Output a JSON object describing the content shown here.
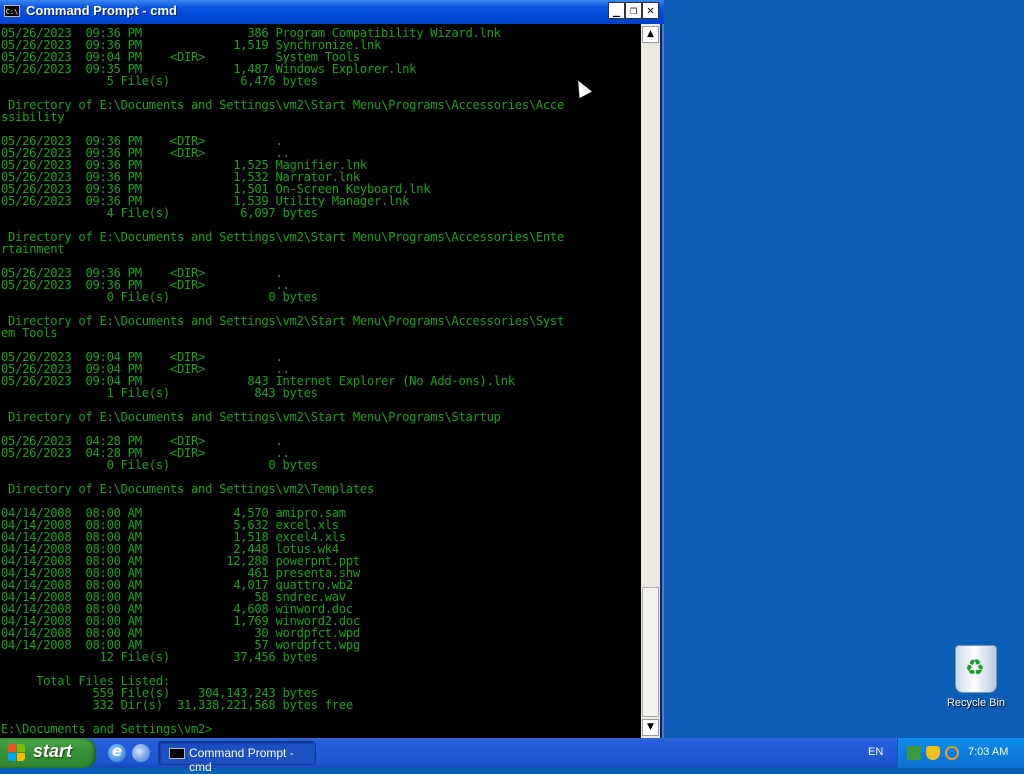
{
  "window": {
    "title": "Command Prompt - cmd",
    "titlebar_icon": "C:\\",
    "minimize_label": "_",
    "maximize_label": "❐",
    "close_label": "✕",
    "console_lines": [
      "05/26/2023  09:36 PM               386 Program Compatibility Wizard.lnk",
      "05/26/2023  09:36 PM             1,519 Synchronize.lnk",
      "05/26/2023  09:04 PM    <DIR>          System Tools",
      "05/26/2023  09:35 PM             1,487 Windows Explorer.lnk",
      "               5 File(s)          6,476 bytes",
      "",
      " Directory of E:\\Documents and Settings\\vm2\\Start Menu\\Programs\\Accessories\\Acce",
      "ssibility",
      "",
      "05/26/2023  09:36 PM    <DIR>          .",
      "05/26/2023  09:36 PM    <DIR>          ..",
      "05/26/2023  09:36 PM             1,525 Magnifier.lnk",
      "05/26/2023  09:36 PM             1,532 Narrator.lnk",
      "05/26/2023  09:36 PM             1,501 On-Screen Keyboard.lnk",
      "05/26/2023  09:36 PM             1,539 Utility Manager.lnk",
      "               4 File(s)          6,097 bytes",
      "",
      " Directory of E:\\Documents and Settings\\vm2\\Start Menu\\Programs\\Accessories\\Ente",
      "rtainment",
      "",
      "05/26/2023  09:36 PM    <DIR>          .",
      "05/26/2023  09:36 PM    <DIR>          ..",
      "               0 File(s)              0 bytes",
      "",
      " Directory of E:\\Documents and Settings\\vm2\\Start Menu\\Programs\\Accessories\\Syst",
      "em Tools",
      "",
      "05/26/2023  09:04 PM    <DIR>          .",
      "05/26/2023  09:04 PM    <DIR>          ..",
      "05/26/2023  09:04 PM               843 Internet Explorer (No Add-ons).lnk",
      "               1 File(s)            843 bytes",
      "",
      " Directory of E:\\Documents and Settings\\vm2\\Start Menu\\Programs\\Startup",
      "",
      "05/26/2023  04:28 PM    <DIR>          .",
      "05/26/2023  04:28 PM    <DIR>          ..",
      "               0 File(s)              0 bytes",
      "",
      " Directory of E:\\Documents and Settings\\vm2\\Templates",
      "",
      "04/14/2008  08:00 AM             4,570 amipro.sam",
      "04/14/2008  08:00 AM             5,632 excel.xls",
      "04/14/2008  08:00 AM             1,518 excel4.xls",
      "04/14/2008  08:00 AM             2,448 lotus.wk4",
      "04/14/2008  08:00 AM            12,288 powerpnt.ppt",
      "04/14/2008  08:00 AM               461 presenta.shw",
      "04/14/2008  08:00 AM             4,017 quattro.wb2",
      "04/14/2008  08:00 AM                58 sndrec.wav",
      "04/14/2008  08:00 AM             4,608 winword.doc",
      "04/14/2008  08:00 AM             1,769 winword2.doc",
      "04/14/2008  08:00 AM                30 wordpfct.wpd",
      "04/14/2008  08:00 AM                57 wordpfct.wpg",
      "              12 File(s)         37,456 bytes",
      "",
      "     Total Files Listed:",
      "             559 File(s)    304,143,243 bytes",
      "             332 Dir(s)  31,338,221,568 bytes free",
      "",
      "E:\\Documents and Settings\\vm2>"
    ],
    "scroll_up": "▲",
    "scroll_down": "▼"
  },
  "desktop": {
    "recycle_bin_label": "Recycle Bin"
  },
  "taskbar": {
    "start_label": "start",
    "task_label": "Command Prompt - cmd",
    "language": "EN",
    "clock": "7:03 AM"
  },
  "colors": {
    "console_text": "#19a319",
    "console_bg": "#000000",
    "desktop_bg": "#0b5db6"
  }
}
